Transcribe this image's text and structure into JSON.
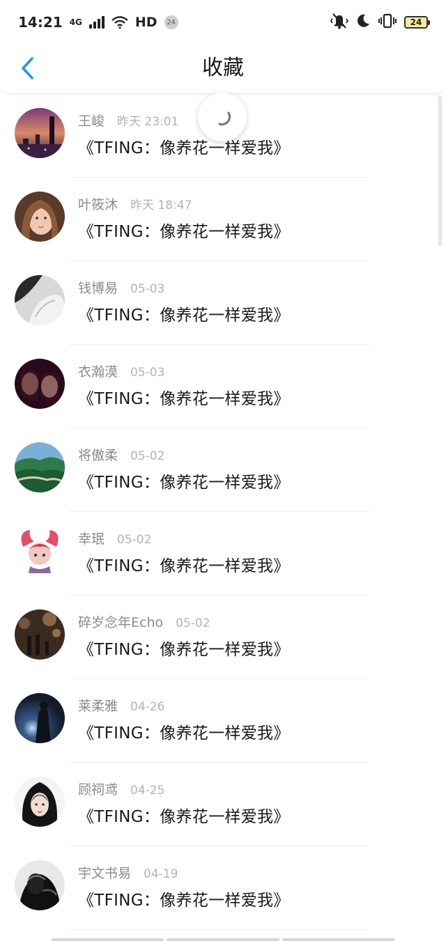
{
  "status_bar": {
    "time": "14:21",
    "network": "4G",
    "hd": "HD",
    "notif_count": "24",
    "battery": "24"
  },
  "header": {
    "title": "收藏",
    "back_icon": "chevron-left-icon"
  },
  "colors": {
    "accent": "#2196f3"
  },
  "items": [
    {
      "name": "王峻",
      "time": "昨天 23:01",
      "title": "《TFING：像养花一样爱我》"
    },
    {
      "name": "叶筱沐",
      "time": "昨天 18:47",
      "title": "《TFING：像养花一样爱我》"
    },
    {
      "name": "钱博易",
      "time": "05-03",
      "title": "《TFING：像养花一样爱我》"
    },
    {
      "name": "衣瀚漠",
      "time": "05-03",
      "title": "《TFING：像养花一样爱我》"
    },
    {
      "name": "将傲柔",
      "time": "05-02",
      "title": "《TFING：像养花一样爱我》"
    },
    {
      "name": "幸珉",
      "time": "05-02",
      "title": "《TFING：像养花一样爱我》"
    },
    {
      "name": "碎岁念年Echo",
      "time": "05-02",
      "title": "《TFING：像养花一样爱我》"
    },
    {
      "name": "莱柔雅",
      "time": "04-26",
      "title": "《TFING：像养花一样爱我》"
    },
    {
      "name": "顾祠鸢",
      "time": "04-25",
      "title": "《TFING：像养花一样爱我》"
    },
    {
      "name": "宇文书易",
      "time": "04-19",
      "title": "《TFING：像养花一样爱我》"
    }
  ]
}
